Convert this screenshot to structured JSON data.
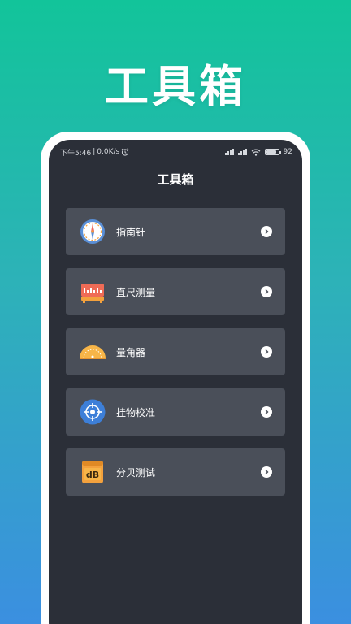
{
  "banner": {
    "title": "工具箱"
  },
  "status_bar": {
    "time": "下午5:46",
    "speed": "0.0K/s",
    "battery": "92"
  },
  "screen": {
    "title": "工具箱"
  },
  "tools": [
    {
      "label": "指南针",
      "icon": "compass-icon"
    },
    {
      "label": "直尺测量",
      "icon": "ruler-icon"
    },
    {
      "label": "量角器",
      "icon": "protractor-icon"
    },
    {
      "label": "挂物校准",
      "icon": "target-icon"
    },
    {
      "label": "分贝测试",
      "icon": "decibel-icon",
      "icon_text": "dB"
    }
  ],
  "colors": {
    "gradient_top": "#12c49a",
    "gradient_bottom": "#3b8fe0",
    "screen_bg": "#2b2f38",
    "card_bg": "#4a4f59",
    "accent_orange": "#f3a13d",
    "accent_blue": "#3d7fd8"
  }
}
